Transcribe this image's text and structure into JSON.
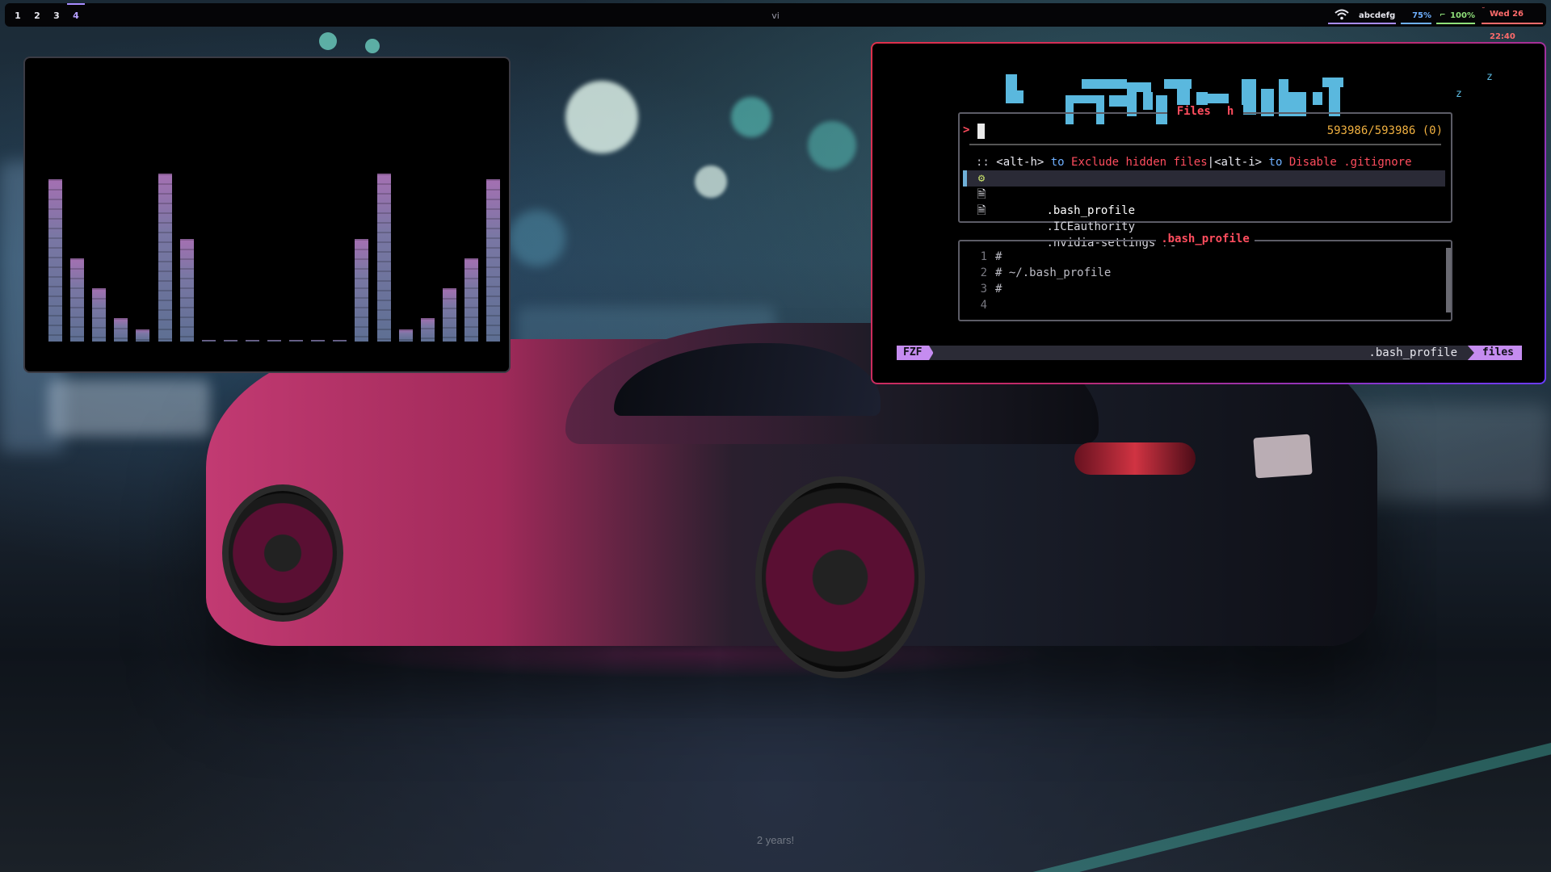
{
  "topbar": {
    "workspaces": [
      "1",
      "2",
      "3",
      "4"
    ],
    "active_workspace": "4",
    "window_title": "vi",
    "wifi_icon": "wifi-icon",
    "network_name": "abcdefg",
    "volume": "75%",
    "battery": "100%",
    "clock": "Wed 26 22:40",
    "colors": {
      "accent": "#a88cff",
      "network": "#a88cff",
      "volume": "#6fb0ff",
      "battery": "#8fe07a",
      "clock": "#ff6b6b"
    }
  },
  "visualizer": {
    "levels": [
      0.82,
      0.42,
      0.27,
      0.12,
      0.06,
      0.85,
      0.52,
      0.01,
      0.01,
      0.01,
      0.01,
      0.01,
      0.01,
      0.01,
      0.52,
      0.85,
      0.06,
      0.12,
      0.27,
      0.42,
      0.82
    ]
  },
  "fzf": {
    "banner_z1": "z",
    "banner_z2": "z",
    "files_title": "Files",
    "files_mode": "h",
    "prompt": ">",
    "match_count": "593986/593986 (0)",
    "hint": {
      "prefix": "::",
      "key1": "<alt-h>",
      "to1": "to",
      "action1": "Exclude hidden files",
      "pipe": "|",
      "key2": "<alt-i>",
      "to2": "to",
      "action2": "Disable .gitignore"
    },
    "files": [
      {
        "name": ".bash_profile",
        "icon": "gear-icon",
        "glyph": "⚙",
        "selected": true
      },
      {
        "name": ".ICEauthority",
        "icon": "file-icon",
        "glyph": "🗎",
        "selected": false
      },
      {
        "name": ".nvidia-settings-rc",
        "icon": "file-icon",
        "glyph": "🗎",
        "selected": false
      }
    ],
    "preview_title": ".bash_profile",
    "preview_lines": [
      {
        "n": "1",
        "text": "#"
      },
      {
        "n": "2",
        "text": "# ~/.bash_profile"
      },
      {
        "n": "3",
        "text": "#"
      },
      {
        "n": "4",
        "text": ""
      }
    ],
    "status_left": "FZF",
    "status_file": ".bash_profile",
    "status_right": "files"
  },
  "wallpaper": {
    "caption": "2 years!"
  }
}
